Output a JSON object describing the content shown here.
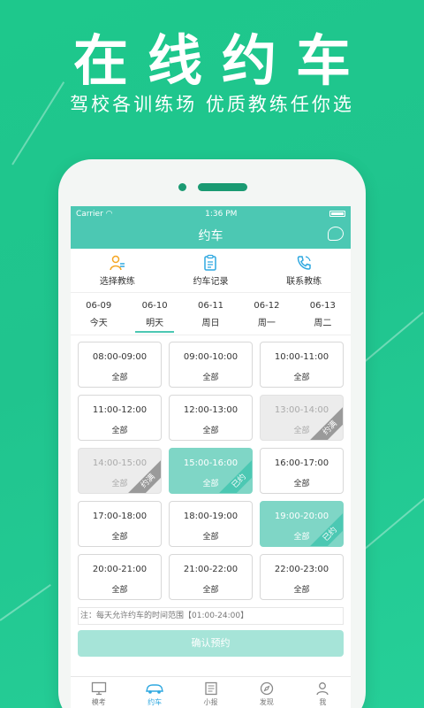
{
  "promo": {
    "headline": "在线约车",
    "subline": "驾校各训练场  优质教练任你选"
  },
  "statusbar": {
    "carrier": "Carrier",
    "time": "1:36 PM"
  },
  "navbar": {
    "title": "约车"
  },
  "quick_actions": [
    {
      "label": "选择教练"
    },
    {
      "label": "约车记录"
    },
    {
      "label": "联系教练"
    }
  ],
  "dates": [
    {
      "date": "06-09",
      "day": "今天"
    },
    {
      "date": "06-10",
      "day": "明天"
    },
    {
      "date": "06-11",
      "day": "周日"
    },
    {
      "date": "06-12",
      "day": "周一"
    },
    {
      "date": "06-13",
      "day": "周二"
    }
  ],
  "slots": [
    {
      "time": "08:00-09:00",
      "status": "全部"
    },
    {
      "time": "09:00-10:00",
      "status": "全部"
    },
    {
      "time": "10:00-11:00",
      "status": "全部"
    },
    {
      "time": "11:00-12:00",
      "status": "全部"
    },
    {
      "time": "12:00-13:00",
      "status": "全部"
    },
    {
      "time": "13:00-14:00",
      "status": "全部",
      "tag": "约满"
    },
    {
      "time": "14:00-15:00",
      "status": "全部",
      "tag": "约满"
    },
    {
      "time": "15:00-16:00",
      "status": "全部",
      "tag": "已约"
    },
    {
      "time": "16:00-17:00",
      "status": "全部"
    },
    {
      "time": "17:00-18:00",
      "status": "全部"
    },
    {
      "time": "18:00-19:00",
      "status": "全部"
    },
    {
      "time": "19:00-20:00",
      "status": "全部",
      "tag": "已约"
    },
    {
      "time": "20:00-21:00",
      "status": "全部"
    },
    {
      "time": "21:00-22:00",
      "status": "全部"
    },
    {
      "time": "22:00-23:00",
      "status": "全部"
    }
  ],
  "note": "注：每天允许约车的时间范围【01:00-24:00】",
  "confirm_label": "确认预约",
  "tabs": [
    {
      "label": "模考"
    },
    {
      "label": "约车"
    },
    {
      "label": "小报"
    },
    {
      "label": "发现"
    },
    {
      "label": "我"
    }
  ],
  "colors": {
    "background": "#20c48e",
    "accent": "#4cc8b3",
    "booked": "#7fd6c6",
    "full": "#ececec",
    "link_blue": "#2fa8e0"
  }
}
